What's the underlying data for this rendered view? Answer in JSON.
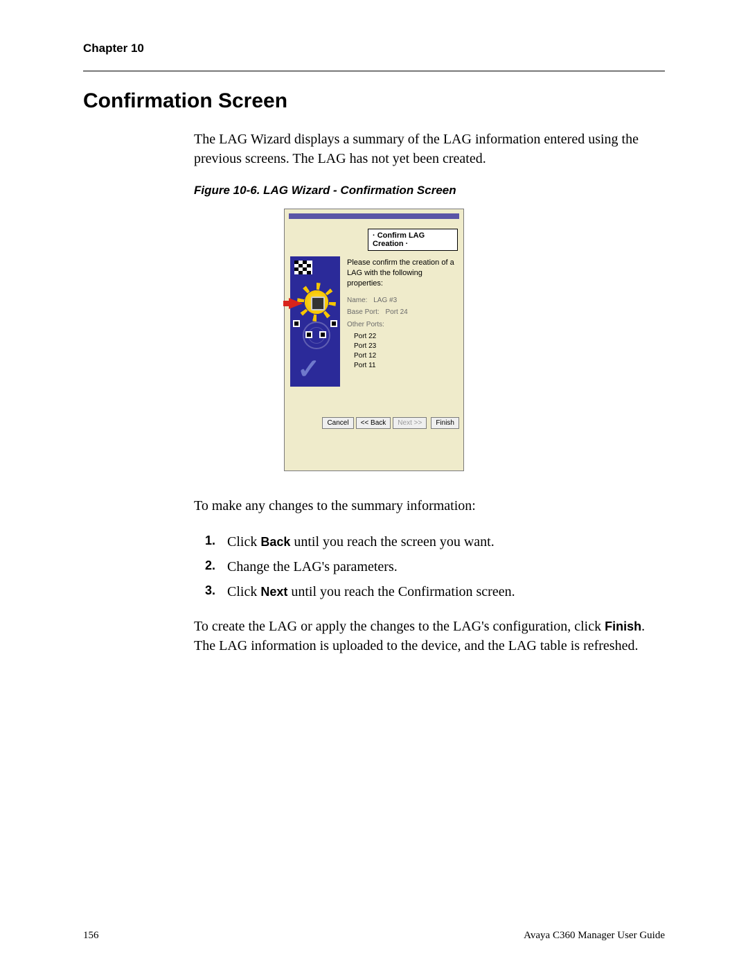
{
  "header": {
    "chapter": "Chapter 10"
  },
  "title": "Confirmation Screen",
  "intro": "The LAG Wizard displays a summary of the LAG information entered using the previous screens. The LAG has not yet been created.",
  "figure": {
    "caption": "Figure 10-6.  LAG Wizard - Confirmation Screen",
    "wizard": {
      "heading": "Confirm LAG Creation",
      "lead": "Please confirm the creation of a LAG with the following properties:",
      "name_label": "Name:",
      "name_value": "LAG #3",
      "baseport_label": "Base Port:",
      "baseport_value": "Port 24",
      "otherports_label": "Other Ports:",
      "ports": [
        "Port 22",
        "Port 23",
        "Port 12",
        "Port 11"
      ],
      "buttons": {
        "cancel": "Cancel",
        "back": "<< Back",
        "next": "Next >>",
        "finish": "Finish"
      }
    }
  },
  "changes_intro": "To make any changes to the summary information:",
  "steps": {
    "s1_pre": "Click ",
    "s1_bold": "Back",
    "s1_post": " until you reach the screen you want.",
    "s2": "Change the LAG's parameters.",
    "s3_pre": "Click ",
    "s3_bold": "Next",
    "s3_post": " until you reach the Confirmation screen."
  },
  "nums": {
    "n1": "1.",
    "n2": "2.",
    "n3": "3."
  },
  "closing": {
    "pre": "To create the LAG or apply the changes to the LAG's configuration, click ",
    "bold": "Finish",
    "post": ". The LAG information is uploaded to the device, and the LAG table is refreshed."
  },
  "footer": {
    "page": "156",
    "book": "Avaya C360 Manager User Guide"
  }
}
